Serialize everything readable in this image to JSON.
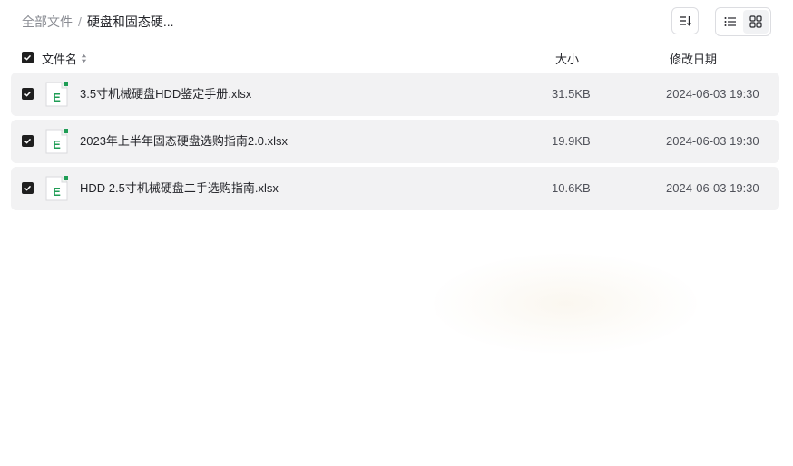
{
  "breadcrumb": {
    "root": "全部文件",
    "separator": "/",
    "current": "硬盘和固态硬..."
  },
  "toolbar": {
    "sort_icon": "sort-list-icon",
    "view_list_icon": "list-view-icon",
    "view_grid_icon": "grid-view-icon",
    "active_view": "list"
  },
  "header": {
    "name": "文件名",
    "size": "大小",
    "date": "修改日期"
  },
  "files": [
    {
      "name": "3.5寸机械硬盘HDD鉴定手册.xlsx",
      "size": "31.5KB",
      "date": "2024-06-03 19:30",
      "checked": true,
      "icon": "excel-file-icon"
    },
    {
      "name": "2023年上半年固态硬盘选购指南2.0.xlsx",
      "size": "19.9KB",
      "date": "2024-06-03 19:30",
      "checked": true,
      "icon": "excel-file-icon"
    },
    {
      "name": "HDD 2.5寸机械硬盘二手选购指南.xlsx",
      "size": "10.6KB",
      "date": "2024-06-03 19:30",
      "checked": true,
      "icon": "excel-file-icon"
    }
  ],
  "colors": {
    "row_bg": "#f2f2f3",
    "excel_green": "#1f9d55",
    "checkbox": "#1f1f1f"
  }
}
